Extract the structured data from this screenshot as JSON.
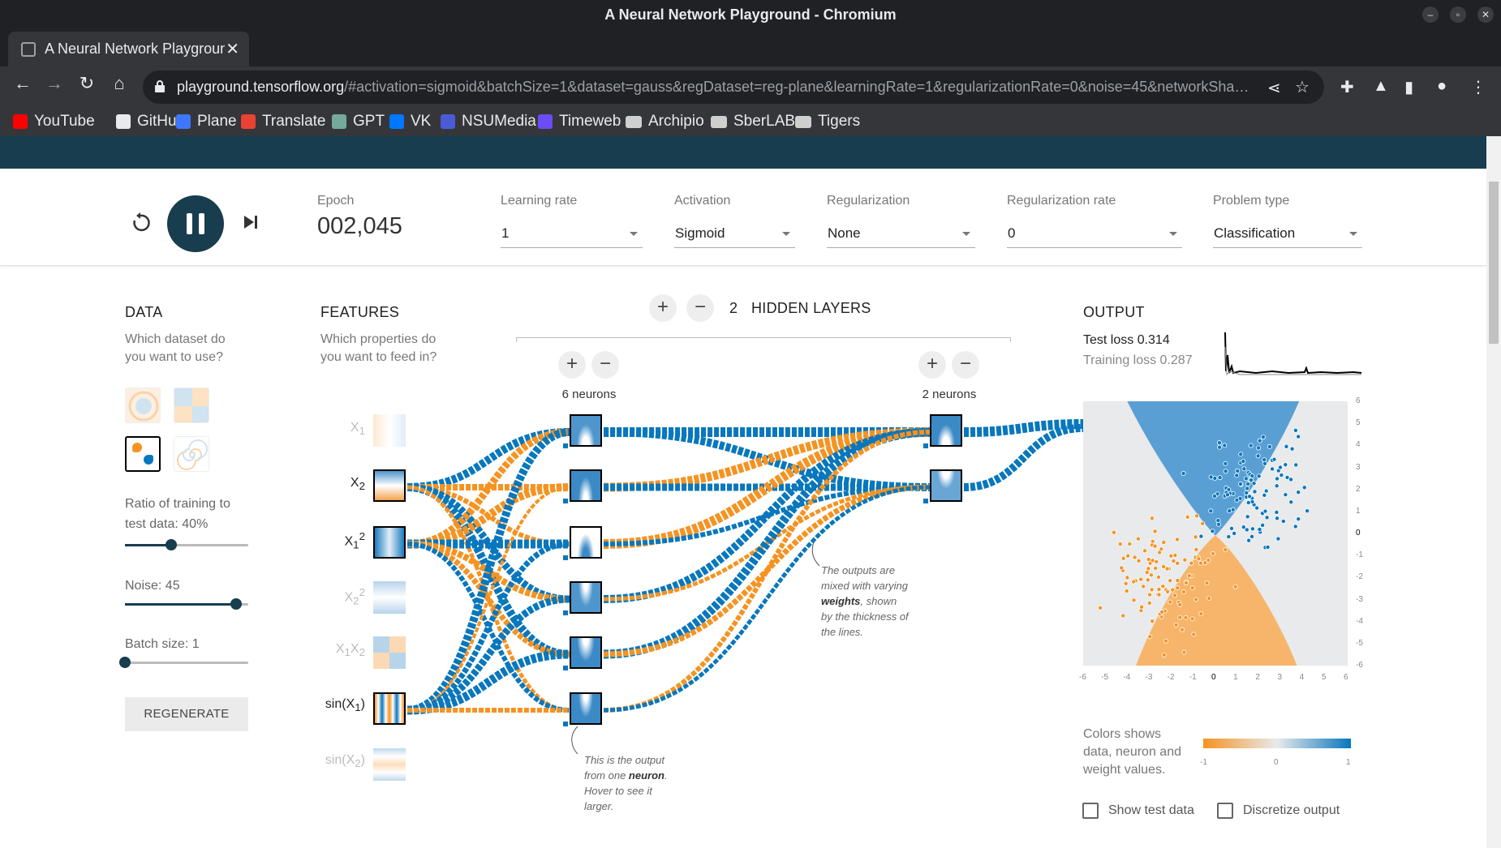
{
  "window": {
    "title": "A Neural Network Playground - Chromium"
  },
  "tab": {
    "title": "A Neural Network Playground"
  },
  "address_bar": {
    "host": "playground.tensorflow.org",
    "path": "/#activation=sigmoid&batchSize=1&dataset=gauss&regDataset=reg-plane&learningRate=1&regularizationRate=0&noise=45&networkSha…"
  },
  "bookmarks": [
    {
      "label": "YouTube",
      "icon": "youtube-icon",
      "color": "#ff0000"
    },
    {
      "label": "GitHub",
      "icon": "github-icon",
      "color": "#e8eaed"
    },
    {
      "label": "Plane",
      "icon": "plane-icon",
      "color": "#3f76ff"
    },
    {
      "label": "Translate",
      "icon": "translate-icon",
      "color": "#e94235"
    },
    {
      "label": "GPT",
      "icon": "gpt-icon",
      "color": "#74aa9c"
    },
    {
      "label": "VK",
      "icon": "vk-icon",
      "color": "#0077ff"
    },
    {
      "label": "NSUMedia",
      "icon": "nsumedia-icon",
      "color": "#4b5bd6"
    },
    {
      "label": "Timeweb",
      "icon": "timeweb-icon",
      "color": "#6b4cf6"
    },
    {
      "label": "Archipio",
      "icon": "folder-icon",
      "color": "#cfcfcf"
    },
    {
      "label": "SberLAB",
      "icon": "folder-icon",
      "color": "#cfcfcf"
    },
    {
      "label": "Tigers",
      "icon": "folder-icon",
      "color": "#cfcfcf"
    }
  ],
  "controls": {
    "epoch_label": "Epoch",
    "epoch_value": "002,045",
    "learning_rate_label": "Learning rate",
    "learning_rate_value": "1",
    "activation_label": "Activation",
    "activation_value": "Sigmoid",
    "regularization_label": "Regularization",
    "regularization_value": "None",
    "regularization_rate_label": "Regularization rate",
    "regularization_rate_value": "0",
    "problem_type_label": "Problem type",
    "problem_type_value": "Classification"
  },
  "data_panel": {
    "title": "DATA",
    "desc_line1": "Which dataset do",
    "desc_line2": "you want to use?",
    "ratio_line1": "Ratio of training to",
    "ratio_line2": "test data:  40%",
    "ratio_value": 40,
    "noise_label": "Noise:  45",
    "noise_value": 45,
    "batch_label": "Batch size:  1",
    "batch_value": 1,
    "regenerate": "REGENERATE",
    "selected_dataset": "gauss"
  },
  "features_panel": {
    "title": "FEATURES",
    "desc_line1": "Which properties do",
    "desc_line2": "you want to feed in?",
    "features": [
      {
        "id": "x1",
        "on": false
      },
      {
        "id": "x2",
        "on": true
      },
      {
        "id": "x1sq",
        "on": true
      },
      {
        "id": "x2sq",
        "on": false
      },
      {
        "id": "x1x2",
        "on": false
      },
      {
        "id": "sinx1",
        "on": true
      },
      {
        "id": "sinx2",
        "on": false
      }
    ]
  },
  "network": {
    "hidden_layers_count": "2",
    "hidden_layers_label": "HIDDEN LAYERS",
    "layer1_neurons": "6 neurons",
    "layer2_neurons": "2 neurons"
  },
  "notes": {
    "neuron_note_1": "This is the output",
    "neuron_note_2a": "from one ",
    "neuron_note_2b": "neuron",
    "neuron_note_2c": ".",
    "neuron_note_3": "Hover to see it",
    "neuron_note_4": "larger.",
    "weights_note_1": "The outputs are",
    "weights_note_2": "mixed with varying",
    "weights_note_3a": "weights",
    "weights_note_3b": ", shown",
    "weights_note_4": "by the thickness of",
    "weights_note_5": "the lines."
  },
  "output_panel": {
    "title": "OUTPUT",
    "test_loss": "Test loss 0.314",
    "training_loss": "Training loss 0.287",
    "x_ticks": [
      "-6",
      "-5",
      "-4",
      "-3",
      "-2",
      "-1",
      "0",
      "1",
      "2",
      "3",
      "4",
      "5",
      "6"
    ],
    "y_ticks": [
      "6",
      "5",
      "4",
      "3",
      "2",
      "1",
      "0",
      "-1",
      "-2",
      "-3",
      "-4",
      "-5",
      "-6"
    ],
    "legend_line1": "Colors shows",
    "legend_line2": "data, neuron and",
    "legend_line3": "weight values.",
    "legend_min": "-1",
    "legend_mid": "0",
    "legend_max": "1",
    "show_test_data": "Show test data",
    "discretize_output": "Discretize output"
  },
  "colors": {
    "orange": "#f59322",
    "blue": "#0877bd",
    "dark": "#183d4e"
  }
}
